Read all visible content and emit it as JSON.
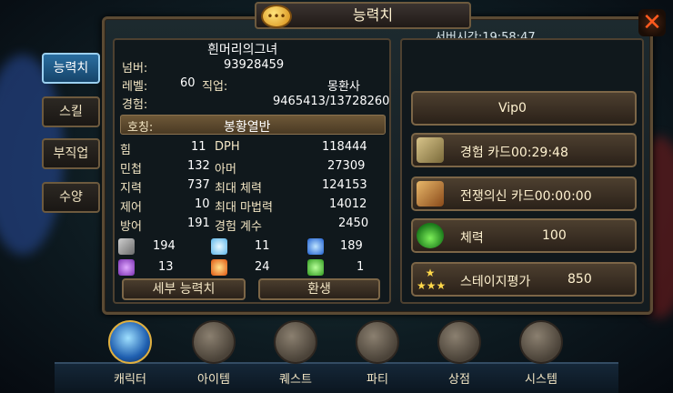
{
  "header": {
    "title": "능력치",
    "server_time": "서버시간:19:58:47",
    "close_label": "✕"
  },
  "tabs": [
    "능력치",
    "스킬",
    "부직업",
    "수양"
  ],
  "profile": {
    "name": "흰머리의그녀",
    "number_label": "넘버:",
    "number_value": "93928459",
    "level_label": "레벨:",
    "level_value": "60",
    "job_label": "직업:",
    "job_value": "몽환사",
    "exp_label": "경험:",
    "exp_value": "9465413/13728260",
    "honor_label": "호칭:",
    "honor_value": "봉황열반"
  },
  "stats": [
    {
      "name": "힘",
      "value": "11",
      "sub_label": "DPH",
      "sub_value": "118444"
    },
    {
      "name": "민첩",
      "value": "132",
      "sub_label": "아머",
      "sub_value": "27309"
    },
    {
      "name": "지력",
      "value": "737",
      "sub_label": "최대 체력",
      "sub_value": "124153"
    },
    {
      "name": "제어",
      "value": "10",
      "sub_label": "최대 마법력",
      "sub_value": "14012"
    },
    {
      "name": "방어",
      "value": "191",
      "sub_label": "경험 계수",
      "sub_value": "2450"
    }
  ],
  "resists": [
    "194",
    "11",
    "189",
    "13",
    "24",
    "1"
  ],
  "buttons": {
    "detail": "세부 능력치",
    "rebirth": "환생"
  },
  "right": {
    "vip": "Vip0",
    "exp_card": "경험 카드00:29:48",
    "war_card": "전쟁의신 카드00:00:00",
    "stamina_label": "체력",
    "stamina_value": "100",
    "stage_label": "스테이지평가",
    "stage_value": "850"
  },
  "nav": [
    "캐릭터",
    "아이템",
    "퀘스트",
    "파티",
    "상점",
    "시스템"
  ]
}
